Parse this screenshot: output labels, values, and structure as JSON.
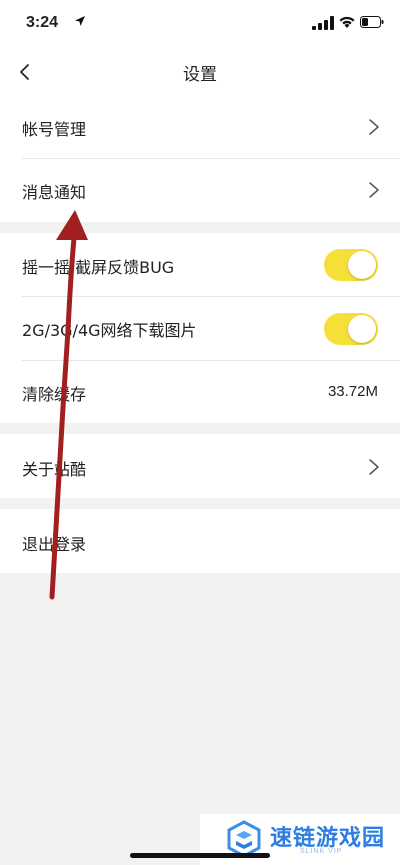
{
  "status_bar": {
    "time": "3:24"
  },
  "nav": {
    "title": "设置"
  },
  "section1": {
    "items": [
      {
        "label": "帐号管理"
      },
      {
        "label": "消息通知"
      }
    ]
  },
  "section2": {
    "shake_label": "摇一摇,截屏反馈BUG",
    "shake_on": true,
    "network_label": "2G/3G/4G网络下载图片",
    "network_on": true,
    "cache_label": "清除缓存",
    "cache_value": "33.72M"
  },
  "section3": {
    "about_label": "关于站酷"
  },
  "section4": {
    "logout_label": "退出登录"
  },
  "watermark": {
    "name": "速链游戏园",
    "sub": "SLINK VIP"
  },
  "colors": {
    "toggle_on": "#f7df3a",
    "annotation_arrow": "#a11f1f",
    "watermark": "#2e7de1"
  }
}
